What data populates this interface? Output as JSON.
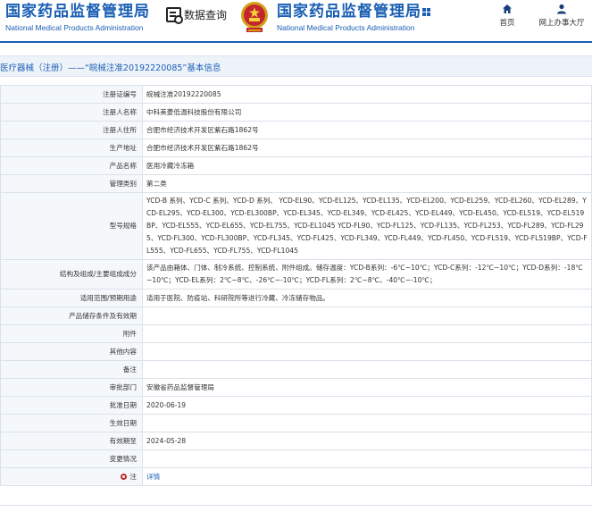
{
  "header": {
    "brand_title": "国家药品监督管理局",
    "brand_subtitle": "National Medical Products Administration",
    "data_query_label": "数据查询",
    "brand_title_right": "国家药品监督管理局",
    "brand_subtitle_right": "National Medical Products Administration",
    "nav": [
      {
        "label": "首页",
        "icon": "home-icon"
      },
      {
        "label": "网上办事大厅",
        "icon": "user-icon"
      }
    ],
    "accent_color": "#1a5fb4"
  },
  "breadcrumb": "医疗器械（注册）——“皖械注准20192220085”基本信息",
  "rows": [
    {
      "label": "注册证编号",
      "value": "皖械注准20192220085"
    },
    {
      "label": "注册人名称",
      "value": "中科美菱低温科技股份有限公司"
    },
    {
      "label": "注册人住所",
      "value": "合肥市经济技术开发区紫石路1862号"
    },
    {
      "label": "生产地址",
      "value": "合肥市经济技术开发区紫石路1862号"
    },
    {
      "label": "产品名称",
      "value": "医用冷藏冷冻箱"
    },
    {
      "label": "管理类别",
      "value": "第二类"
    },
    {
      "label": "型号规格",
      "value": "YCD-B 系列、YCD-C 系列、YCD-D 系列、 YCD-EL90、YCD-EL125、YCD-EL135、YCD-EL200、YCD-EL259、YCD-EL260、YCD-EL289、YCD-EL295、YCD-EL300、YCD-EL300BP、YCD-EL345、YCD-EL349、YCD-EL425、YCD-EL449、YCD-EL450、YCD-EL519、YCD-EL519BP、YCD-EL555、YCD-EL655、YCD-EL755、YCD-EL1045 YCD-FL90、YCD-FL125、YCD-FL135、YCD-FL253、YCD-FL289、YCD-FL295、YCD-FL300、YCD-FL300BP、YCD-FL345、YCD-FL425、YCD-FL349、YCD-FL449、YCD-FL450、YCD-FL519、YCD-FL519BP、YCD-FL555、YCD-FL655、YCD-FL755、YCD-FL1045"
    },
    {
      "label": "结构及组成/主要组成成分",
      "value": "该产品由箱体、门体、制冷系统、控制系统、附件组成。储存温度：YCD-B系列：-6℃~10℃；YCD-C系列：-12℃~10℃；YCD-D系列：-18℃~10℃；YCD-EL系列：2℃~8℃、-26℃~-10℃；YCD-FL系列：2℃~8℃、-40℃~-10℃；"
    },
    {
      "label": "适用范围/预期用途",
      "value": "适用于医院、防疫站、科研院所等进行冷藏、冷冻储存物品。"
    },
    {
      "label": "产品储存条件及有效期",
      "value": ""
    },
    {
      "label": "附件",
      "value": ""
    },
    {
      "label": "其他内容",
      "value": ""
    },
    {
      "label": "备注",
      "value": ""
    },
    {
      "label": "审批部门",
      "value": "安徽省药品监督管理局"
    },
    {
      "label": "批准日期",
      "value": "2020-06-19"
    },
    {
      "label": "生效日期",
      "value": ""
    },
    {
      "label": "有效期至",
      "value": "2024-05-28"
    },
    {
      "label": "变更情况",
      "value": ""
    }
  ],
  "note_row": {
    "label": "注",
    "link_label": "详情",
    "icon": "pin-icon"
  }
}
